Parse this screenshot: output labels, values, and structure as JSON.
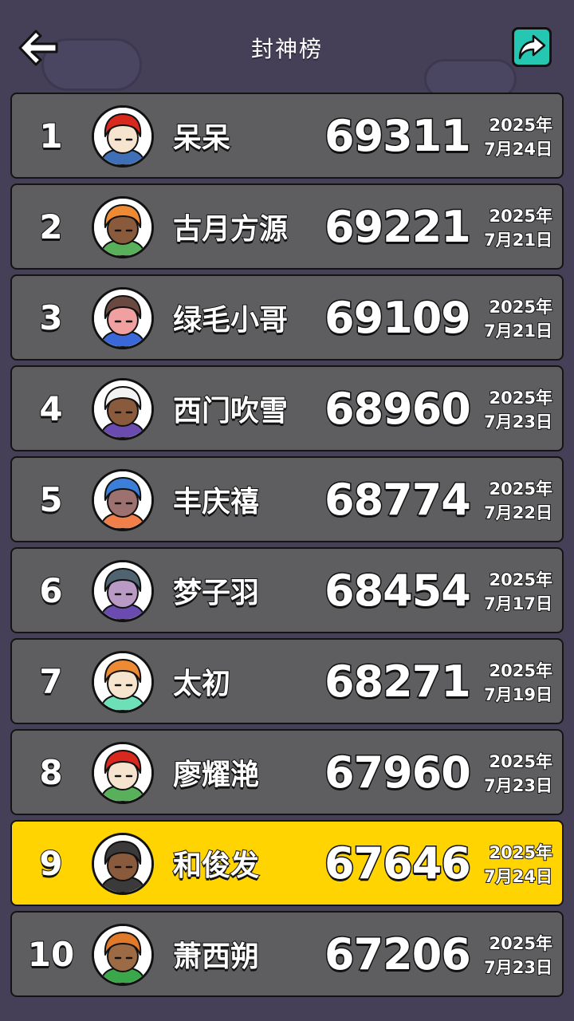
{
  "header": {
    "title": "封神榜",
    "back_icon": "arrow-left-icon",
    "share_icon": "share-icon"
  },
  "colors": {
    "background": "#454057",
    "row": "#5e5e60",
    "highlight": "#ffd400",
    "share": "#25c7b3"
  },
  "rows": [
    {
      "rank": "1",
      "name": "呆呆",
      "score": "69311",
      "year": "2025年",
      "day": "7月24日",
      "hair": "#d9281e",
      "skin": "#f6e4cf",
      "shirt": "#3f6fb6"
    },
    {
      "rank": "2",
      "name": "古月方源",
      "score": "69221",
      "year": "2025年",
      "day": "7月21日",
      "hair": "#ef8a34",
      "skin": "#8a5a3c",
      "shirt": "#59b05a"
    },
    {
      "rank": "3",
      "name": "绿毛小哥",
      "score": "69109",
      "year": "2025年",
      "day": "7月21日",
      "hair": "#6a4a40",
      "skin": "#f1a0a0",
      "shirt": "#3b68d8"
    },
    {
      "rank": "4",
      "name": "西门吹雪",
      "score": "68960",
      "year": "2025年",
      "day": "7月23日",
      "hair": "#f2f2f2",
      "skin": "#8a5a3c",
      "shirt": "#6a4bb0"
    },
    {
      "rank": "5",
      "name": "丰庆禧",
      "score": "68774",
      "year": "2025年",
      "day": "7月22日",
      "hair": "#3b7fd8",
      "skin": "#9c7170",
      "shirt": "#f07f4a"
    },
    {
      "rank": "6",
      "name": "梦子羽",
      "score": "68454",
      "year": "2025年",
      "day": "7月17日",
      "hair": "#4f6470",
      "skin": "#b89ac4",
      "shirt": "#6a4bb0"
    },
    {
      "rank": "7",
      "name": "太初",
      "score": "68271",
      "year": "2025年",
      "day": "7月19日",
      "hair": "#ef8a34",
      "skin": "#f6e4cf",
      "shirt": "#6de0b8"
    },
    {
      "rank": "8",
      "name": "廖耀滟",
      "score": "67960",
      "year": "2025年",
      "day": "7月23日",
      "hair": "#d9281e",
      "skin": "#f6e4cf",
      "shirt": "#59b05a"
    },
    {
      "rank": "9",
      "name": "和俊发",
      "score": "67646",
      "year": "2025年",
      "day": "7月24日",
      "hair": "#3a3a3a",
      "skin": "#8a5a3c",
      "shirt": "#3a3a3a",
      "me": true
    },
    {
      "rank": "10",
      "name": "萧西朔",
      "score": "67206",
      "year": "2025年",
      "day": "7月23日",
      "hair": "#e07a2a",
      "skin": "#9c6a45",
      "shirt": "#3aa84a"
    }
  ]
}
